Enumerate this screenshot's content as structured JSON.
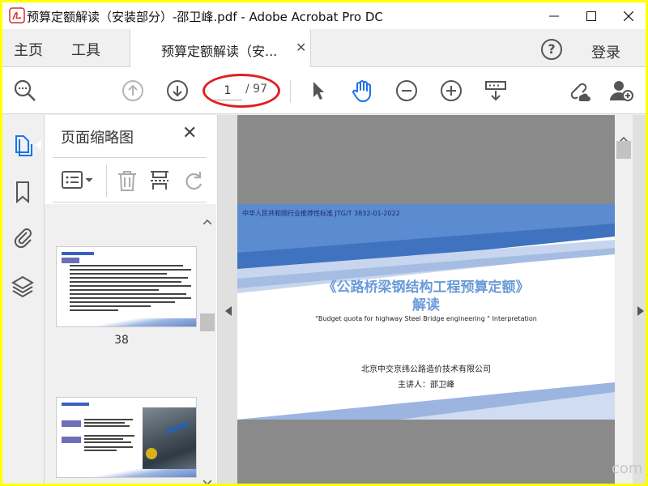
{
  "window": {
    "title": "预算定额解读（安装部分）-邵卫峰.pdf - Adobe Acrobat Pro DC"
  },
  "tabs": {
    "home": "主页",
    "tools": "工具",
    "document": "预算定额解读（安...",
    "help": "?",
    "login": "登录"
  },
  "toolbar": {
    "page_current": "1",
    "page_total": "/ 97"
  },
  "thumbnails": {
    "title": "页面缩略图",
    "pages": [
      {
        "label": "38"
      }
    ]
  },
  "slide": {
    "header": "中华人民共和国行业推荐性标准   JTG/T 3832-01-2022",
    "title": "《公路桥梁钢结构工程预算定额》",
    "subtitle": "解读",
    "english": "\"Budget quota for highway Steel Bridge engineering \" Interpretation",
    "company": "北京中交京纬公路造价技术有限公司",
    "presenter": "主讲人：邵卫峰"
  },
  "colors": {
    "accent_blue": "#1a73e8",
    "highlight_red": "#e02020",
    "slide_blue": "#6a9bd8",
    "border": "#ffff00"
  },
  "watermark": "com"
}
